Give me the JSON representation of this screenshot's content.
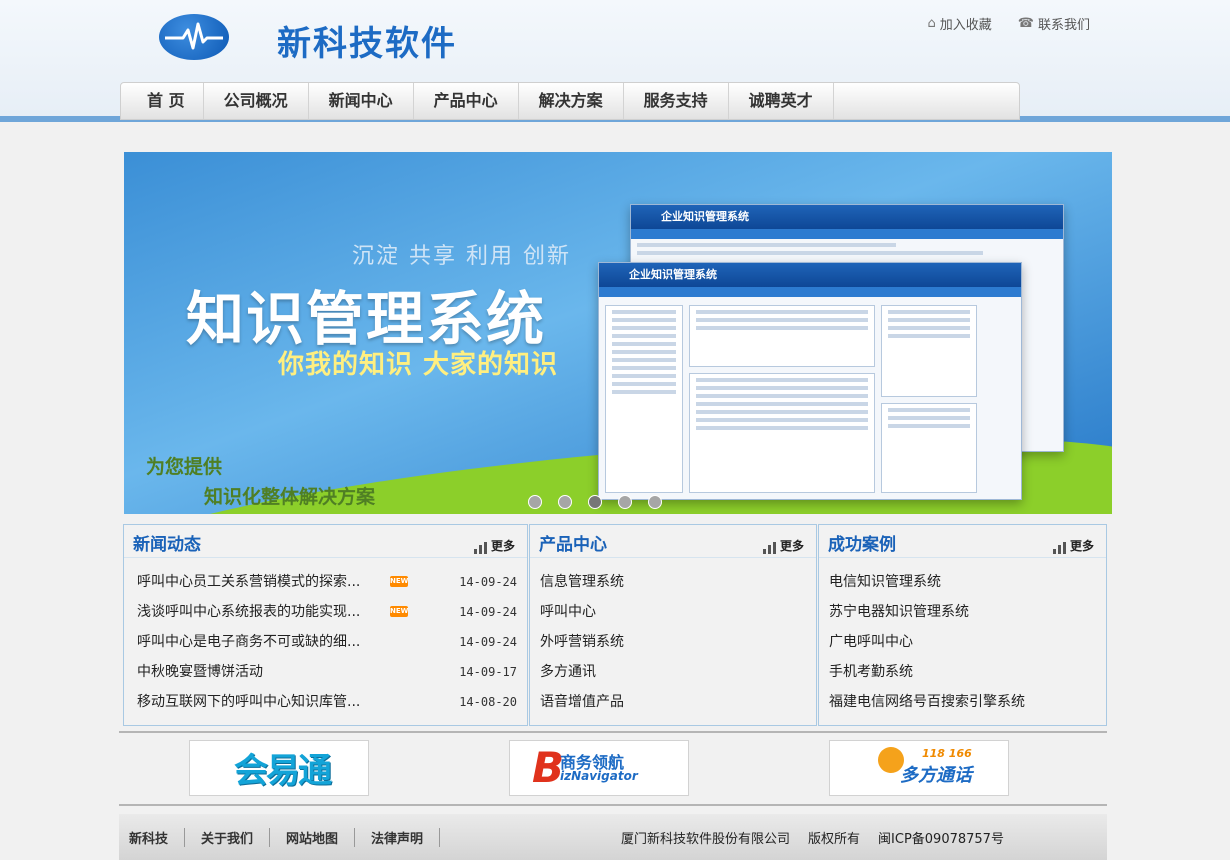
{
  "header": {
    "logo_text": "新科技软件",
    "top_links": [
      {
        "label": "加入收藏",
        "icon": "home-icon"
      },
      {
        "label": "联系我们",
        "icon": "phone-icon"
      }
    ]
  },
  "nav": {
    "items": [
      "首 页",
      "公司概况",
      "新闻中心",
      "产品中心",
      "解决方案",
      "服务支持",
      "诚聘英才"
    ]
  },
  "banner": {
    "tagline": "沉淀 共享 利用 创新",
    "title": "知识管理系统",
    "subtitle": "你我的知识 大家的知识",
    "provide_line1": "为您提供",
    "provide_line2": "知识化整体解决方案",
    "screenshot_title": "企业知识管理系统",
    "slide_count": 5,
    "active_slide": 2
  },
  "news": {
    "title": "新闻动态",
    "more": "更多",
    "items": [
      {
        "text": "呼叫中心员工关系营销模式的探索...",
        "date": "14-09-24",
        "is_new": true
      },
      {
        "text": "浅谈呼叫中心系统报表的功能实现...",
        "date": "14-09-24",
        "is_new": true
      },
      {
        "text": "呼叫中心是电子商务不可或缺的细...",
        "date": "14-09-24",
        "is_new": false
      },
      {
        "text": "中秋晚宴暨博饼活动",
        "date": "14-09-17",
        "is_new": false
      },
      {
        "text": "移动互联网下的呼叫中心知识库管...",
        "date": "14-08-20",
        "is_new": false
      }
    ]
  },
  "products": {
    "title": "产品中心",
    "more": "更多",
    "items": [
      "信息管理系统",
      "呼叫中心",
      "外呼营销系统",
      "多方通讯",
      "语音增值产品"
    ]
  },
  "cases": {
    "title": "成功案例",
    "more": "更多",
    "items": [
      "电信知识管理系统",
      "苏宁电器知识管理系统",
      "广电呼叫中心",
      "手机考勤系统",
      "福建电信网络号百搜索引擎系统"
    ]
  },
  "partners": [
    {
      "label": "会易通"
    },
    {
      "label": "商务领航",
      "sub": "izNavigator"
    },
    {
      "label": "多方通话",
      "badge": "118 166"
    }
  ],
  "footer": {
    "links": [
      "新科技",
      "关于我们",
      "网站地图",
      "法律声明"
    ],
    "company": "厦门新科技软件股份有限公司",
    "rights": "版权所有",
    "icp": "闽ICP备09078757号"
  },
  "colors": {
    "brand_blue": "#1d6bc4",
    "title_blue": "#1a62b8",
    "banner_green": "#8ccf2a",
    "new_badge": "#ff8a00"
  }
}
